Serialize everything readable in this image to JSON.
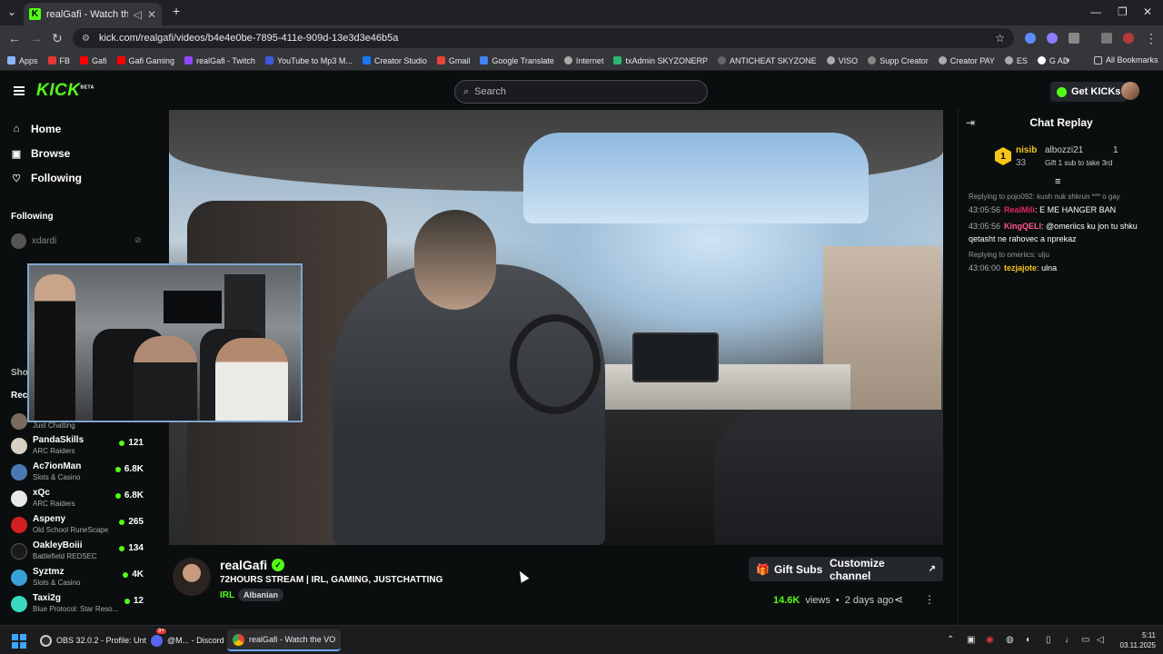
{
  "browser": {
    "tab_title": "realGafi - Watch the VOD o",
    "url": "kick.com/realgafi/videos/b4e4e0be-7895-411e-909d-13e3d3e46b5a",
    "bookmarks": [
      "Apps",
      "FB",
      "Gafi",
      "Gafi Gaming",
      "realGafi - Twitch",
      "YouTube to Mp3 M...",
      "Creator Studio",
      "Gmail",
      "Google Translate",
      "Internet",
      "txAdmin SKYZONERP",
      "ANTICHEAT SKYZONE",
      "VISO",
      "Supp Creator",
      "Creator PAY",
      "ES",
      "G AD"
    ],
    "all_bookmarks": "All Bookmarks"
  },
  "header": {
    "logo": "KICK",
    "logo_beta": "BETA",
    "search_placeholder": "Search",
    "get_kicks": "Get KICKs"
  },
  "sidebar": {
    "nav": [
      "Home",
      "Browse",
      "Following"
    ],
    "following_label": "Following",
    "following_first": "xdardi",
    "short_labels": [
      "Sho",
      "Rec"
    ],
    "recommended": [
      {
        "name": "",
        "category": "Just Chatting",
        "viewers": ""
      },
      {
        "name": "PandaSkills",
        "category": "ARC Raiders",
        "viewers": "121"
      },
      {
        "name": "Ac7ionMan",
        "category": "Slots & Casino",
        "viewers": "6.8K"
      },
      {
        "name": "xQc",
        "category": "ARC Raiders",
        "viewers": "6.8K"
      },
      {
        "name": "Aspeny",
        "category": "Old School RuneScape",
        "viewers": "265"
      },
      {
        "name": "OakleyBoiii",
        "category": "Battlefield REDSEC",
        "viewers": "134"
      },
      {
        "name": "Syztmz",
        "category": "Slots & Casino",
        "viewers": "4K"
      },
      {
        "name": "Taxi2g",
        "category": "Blue Protocol: Star Reso...",
        "viewers": "12"
      }
    ]
  },
  "channel": {
    "name": "realGafi",
    "title": "72HOURS STREAM | IRL, GAMING, JUSTCHATTING",
    "category": "IRL",
    "tag": "Albanian",
    "gift_subs": "Gift Subs",
    "customize": "Customize channel",
    "views": "14.6K",
    "views_label": "views",
    "age": "2 days ago"
  },
  "chat": {
    "title": "Chat Replay",
    "pinned": {
      "rank": "1",
      "user": "nisib",
      "count": "33",
      "user2": "albozzi21",
      "n": "1",
      "gift_text": "Gift 1 sub to take 3rd"
    },
    "messages": [
      {
        "reply": "Replying to pojo092: kush nuk shkrun *** o gay",
        "time": "43:05:56",
        "user": "RealMili",
        "text": ": E ME HANGER BAN",
        "color": "red"
      },
      {
        "reply": "",
        "time": "43:05:56",
        "user": "KingQELI",
        "text": ": @omeriics ku jon tu shku qetasht ne rahovec a nprekaz",
        "color": "pink"
      },
      {
        "reply": "Replying to omeriics: ulju",
        "time": "43:06:00",
        "user": "tezjajote",
        "text": ": ulna",
        "color": "yellow"
      }
    ]
  },
  "taskbar": {
    "tasks": [
      "OBS 32.0.2 - Profile: Unt",
      "@M... - Discord",
      "realGafi - Watch the VO"
    ],
    "discord_badge": "9+",
    "time": "5:11",
    "date": "03.11.2025"
  },
  "colors": {
    "kick_green": "#53fc18",
    "bg": "#0b0e0f",
    "gold": "#f5c518"
  }
}
